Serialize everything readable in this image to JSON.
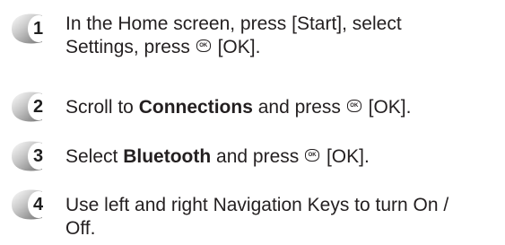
{
  "steps": [
    {
      "number": "1",
      "line1": "In the Home screen, press [Start], select",
      "line2_pre": "Settings, press",
      "line2_post": "[OK]."
    },
    {
      "number": "2",
      "pre": "Scroll to ",
      "bold": "Connections",
      "mid": " and press",
      "post": "[OK]."
    },
    {
      "number": "3",
      "pre": "Select ",
      "bold": "Bluetooth",
      "mid": " and press",
      "post": "[OK]."
    },
    {
      "number": "4",
      "line1": "Use left and right Navigation Keys to turn On /",
      "line2": "Off."
    }
  ],
  "ok_icon_label": "OK",
  "colors": {
    "badge_light": "#ffffff",
    "badge_dark": "#8c8c8c",
    "text": "#231f20"
  }
}
